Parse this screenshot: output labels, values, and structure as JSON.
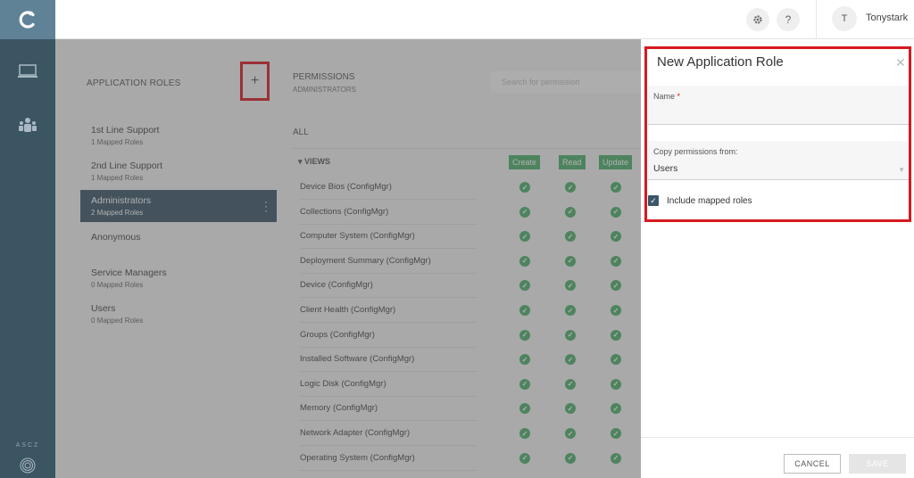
{
  "header": {
    "username": "Tonystark",
    "avatar_initial": "T",
    "settings_icon": "gear-icon",
    "help_label": "?"
  },
  "nav": {
    "logo_icon": "logo-c-icon",
    "items": [
      {
        "icon": "laptop-icon"
      },
      {
        "icon": "users-icon"
      }
    ],
    "version": "ASCZ"
  },
  "roles": {
    "title": "APPLICATION ROLES",
    "add_label": "+",
    "items": [
      {
        "name": "1st Line Support",
        "sub": "1 Mapped Roles"
      },
      {
        "name": "2nd Line Support",
        "sub": "1 Mapped Roles"
      },
      {
        "name": "Administrators",
        "sub": "2 Mapped Roles"
      },
      {
        "name": "Anonymous",
        "sub": ""
      },
      {
        "name": "Service Managers",
        "sub": "0 Mapped Roles"
      },
      {
        "name": "Users",
        "sub": "0 Mapped Roles"
      }
    ]
  },
  "permissions": {
    "title": "PERMISSIONS",
    "subtitle": "ADMINISTRATORS",
    "search_placeholder": "Search for permission",
    "all_label": "ALL",
    "views_label": "VIEWS",
    "columns": [
      "Create",
      "Read",
      "Update"
    ],
    "rows": [
      "Device Bios (ConfigMgr)",
      "Collections (ConfigMgr)",
      "Computer System (ConfigMgr)",
      "Deployment Summary (ConfigMgr)",
      "Device (ConfigMgr)",
      "Client Health (ConfigMgr)",
      "Groups (ConfigMgr)",
      "Installed Software (ConfigMgr)",
      "Logic Disk (ConfigMgr)",
      "Memory (ConfigMgr)",
      "Network Adapter (ConfigMgr)",
      "Operating System (ConfigMgr)"
    ]
  },
  "panel": {
    "title": "New Application Role",
    "name_label": "Name",
    "required_mark": "*",
    "copy_label": "Copy permissions from:",
    "copy_value": "Users",
    "include_label": "Include mapped roles",
    "include_checked": true,
    "cancel_label": "CANCEL",
    "save_label": "SAVE"
  },
  "colors": {
    "rail": "#3b5563",
    "accent_green": "#4caf6a",
    "highlight_red": "#d7191f"
  }
}
